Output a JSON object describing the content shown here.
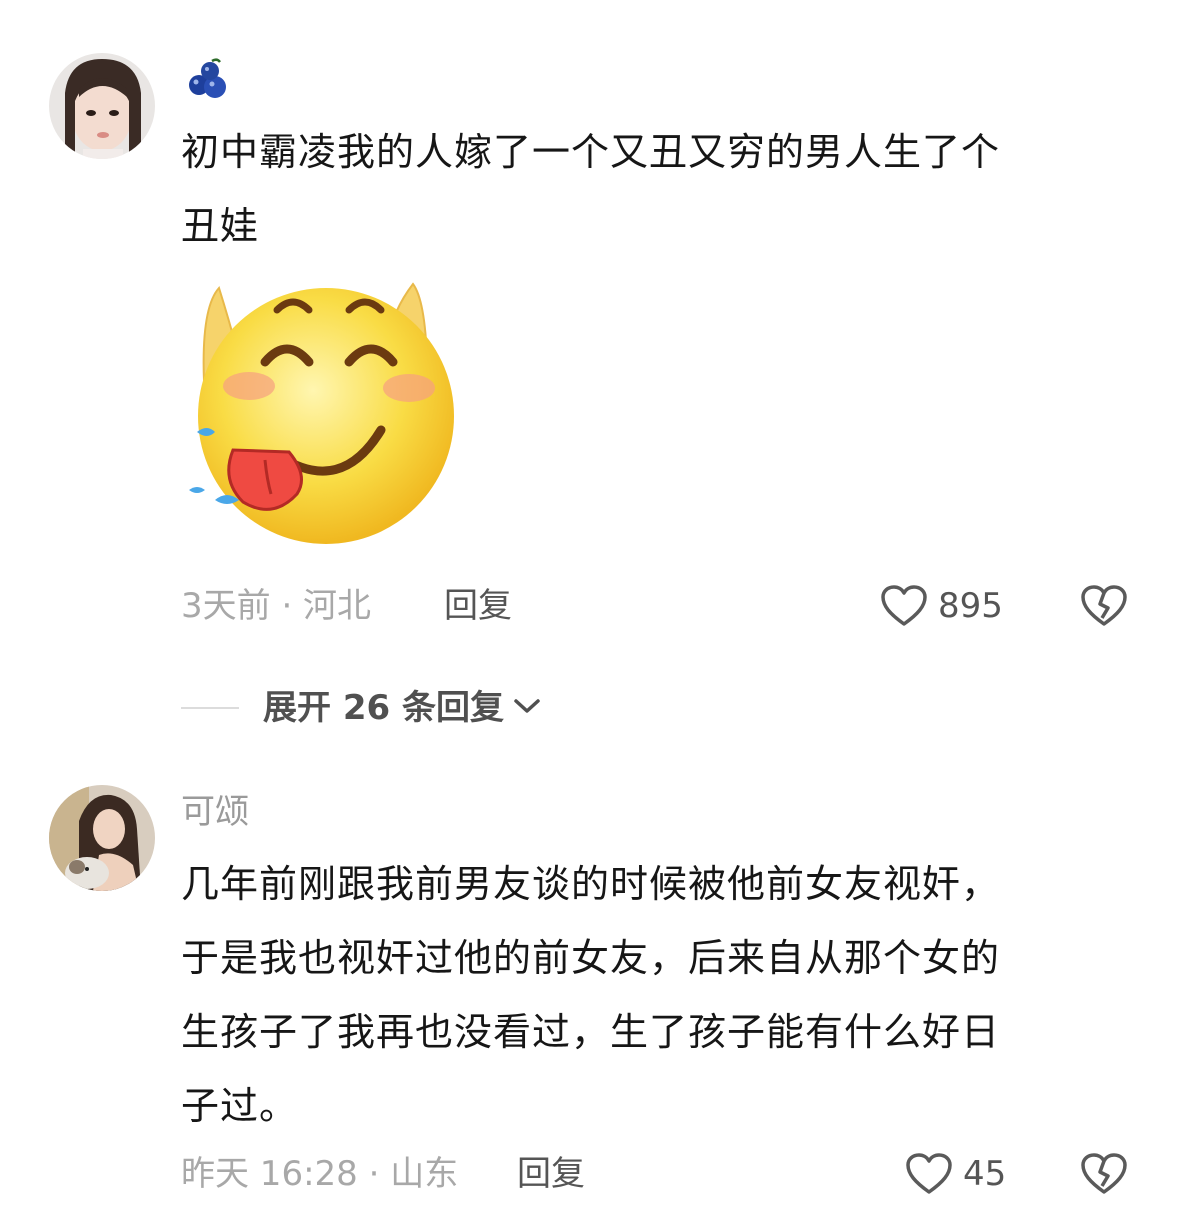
{
  "comments": [
    {
      "username": "",
      "username_icon": "blueberry-icon",
      "text_lines": [
        "初中霸凌我的人嫁了一个又丑又穷的男人生了个",
        "丑娃"
      ],
      "sticker": "tongue-out-smiley-sticker",
      "meta": "3天前 · 河北",
      "reply_label": "回复",
      "likes": "895"
    },
    {
      "username": "可颂",
      "text_lines": [
        "几年前刚跟我前男友谈的时候被他前女友视奸，",
        "于是我也视奸过他的前女友，后来自从那个女的",
        "生孩子了我再也没看过，生了孩子能有什么好日",
        "子过。"
      ],
      "meta": "昨天 16:28 · 山东",
      "reply_label": "回复",
      "likes": "45"
    }
  ],
  "expand_replies": "展开 26 条回复",
  "colors": {
    "meta": "#a8a8a8",
    "text": "#161616",
    "sticker_face": "#f7d23a"
  }
}
